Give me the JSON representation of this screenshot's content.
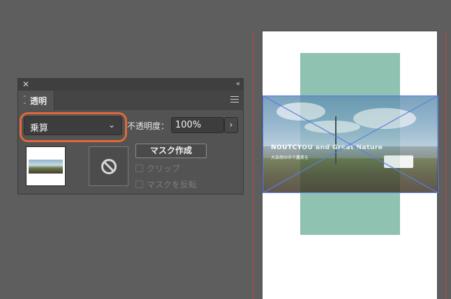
{
  "panel": {
    "tab_label": "透明",
    "blend_mode": {
      "value": "乗算"
    },
    "opacity": {
      "label": "不透明度：",
      "value": "100%"
    },
    "make_mask_label": "マスク作成",
    "clip_label": "クリップ",
    "invert_mask_label": "マスクを反転"
  },
  "artwork": {
    "photo_title": "NOUTCYOU and Great Nature",
    "photo_subtitle": "大自然の中で農業を"
  },
  "colors": {
    "highlight": "#e0683b",
    "bleed_guide": "#c0463a",
    "selection": "#5b7fe0",
    "green_rect": "#8fc2b1"
  },
  "icons": {
    "close": "close-icon",
    "collapse": "collapse-icon",
    "menu": "hamburger-menu-icon",
    "chevron": "chevron-down-icon",
    "no_mask": "no-symbol-icon"
  }
}
